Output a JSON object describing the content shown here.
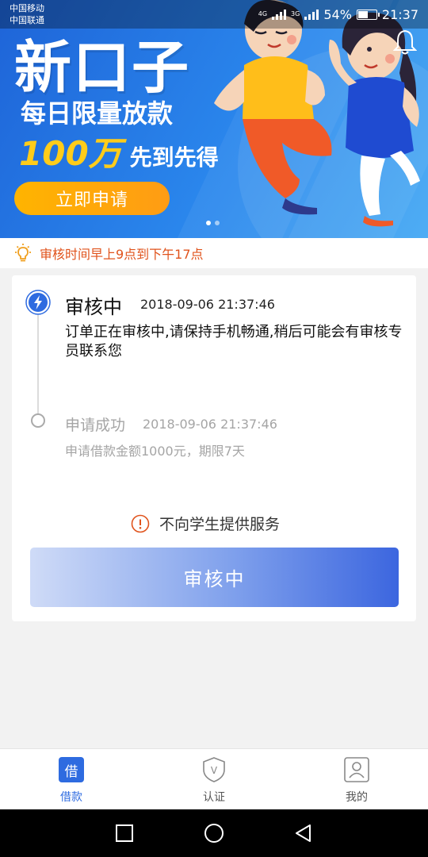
{
  "status_bar": {
    "carrier_1": "中国移动",
    "carrier_2": "中国联通",
    "network_1": "4G",
    "network_2": "3G",
    "battery": "54%",
    "time": "21:37"
  },
  "banner": {
    "headline": "新口子",
    "subline": "每日限量放款",
    "amount": "100万",
    "amount_suffix": "先到先得",
    "apply_button": "立即申请",
    "notification_icon": "bell-icon",
    "carousel_active_index": 0,
    "carousel_count": 2
  },
  "notice": {
    "icon": "lightbulb-icon",
    "text": "审核时间早上9点到下午17点",
    "color": "#e0531c"
  },
  "order": {
    "steps": [
      {
        "title": "审核中",
        "time": "2018-09-06 21:37:46",
        "description": "订单正在审核中,请保持手机畅通,稍后可能会有审核专员联系您",
        "icon": "lightning-icon",
        "active": true
      },
      {
        "title": "申请成功",
        "time": "2018-09-06 21:37:46",
        "description": "申请借款金额1000元，期限7天",
        "active": false
      }
    ],
    "warning": "不向学生提供服务",
    "status_button": "审核中"
  },
  "tabs": [
    {
      "label": "借款",
      "icon": "借",
      "active": true
    },
    {
      "label": "认证",
      "icon": "V",
      "active": false
    },
    {
      "label": "我的",
      "icon": "person-icon",
      "active": false
    }
  ],
  "colors": {
    "accent": "#2e6be0",
    "banner_blue": "#2a86ec",
    "apply_orange": "#ff9c14",
    "warning_orange": "#e0531c"
  }
}
